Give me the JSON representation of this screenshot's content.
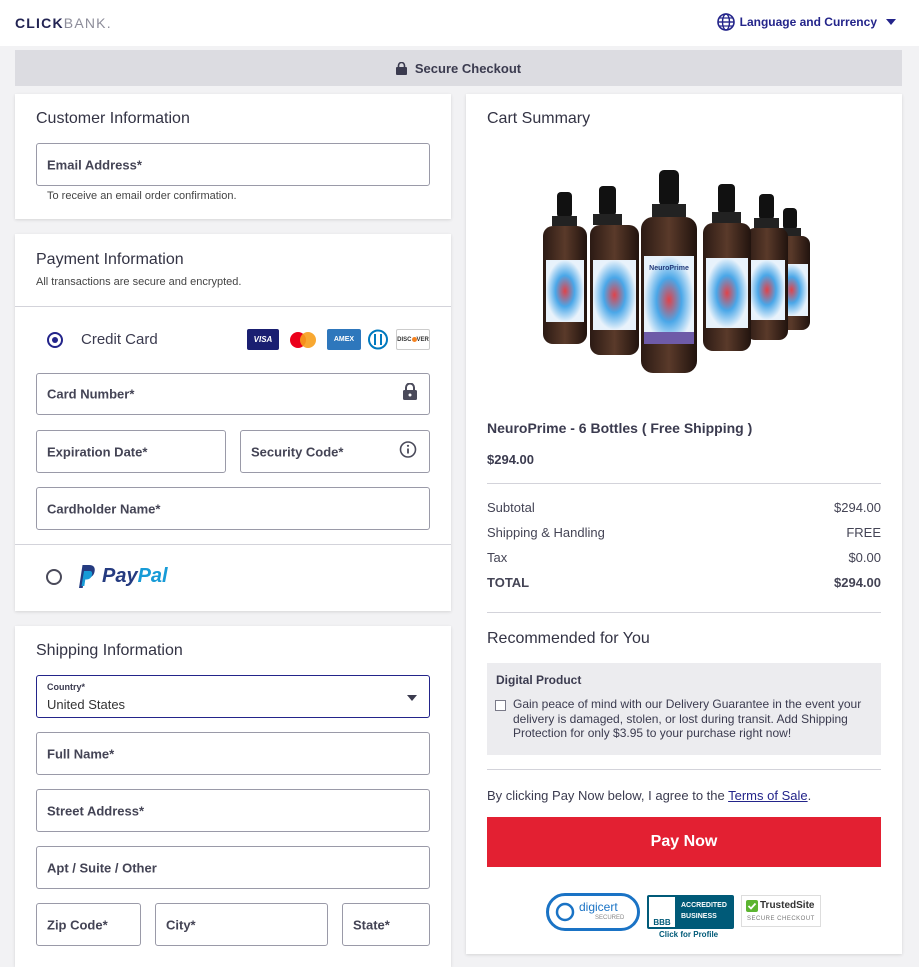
{
  "header": {
    "logo_main": "CLICK",
    "logo_secondary": "BANK.",
    "language_label": "Language and Currency"
  },
  "secure_bar": {
    "label": "Secure Checkout"
  },
  "customer": {
    "title": "Customer Information",
    "email_label": "Email Address*",
    "email_hint": "To receive an email order confirmation."
  },
  "payment": {
    "title": "Payment Information",
    "subtitle": "All transactions are secure and encrypted.",
    "credit_card_label": "Credit Card",
    "card_brands": [
      "VISA",
      "MC",
      "AMEX",
      "DINERS",
      "DISCOVER"
    ],
    "card_number_label": "Card Number*",
    "expiration_label": "Expiration Date*",
    "security_code_label": "Security Code*",
    "cardholder_label": "Cardholder Name*",
    "paypal_label_1": "Pay",
    "paypal_label_2": "Pal",
    "selected_method": "credit_card"
  },
  "shipping": {
    "title": "Shipping Information",
    "country_label": "Country*",
    "country_value": "United States",
    "full_name_label": "Full Name*",
    "street_label": "Street Address*",
    "apt_label": "Apt / Suite / Other",
    "zip_label": "Zip Code*",
    "city_label": "City*",
    "state_label": "State*"
  },
  "cart": {
    "title": "Cart Summary",
    "product_name": "NeuroPrime - 6 Bottles ( Free Shipping )",
    "product_price": "$294.00",
    "bottle_brand": "NeuroPrime",
    "lines": [
      {
        "label": "Subtotal",
        "value": "$294.00"
      },
      {
        "label": "Shipping & Handling",
        "value": "FREE"
      },
      {
        "label": "Tax",
        "value": "$0.00"
      },
      {
        "label": "TOTAL",
        "value": "$294.00"
      }
    ],
    "recommended_title": "Recommended for You",
    "digital_product_title": "Digital Product",
    "protection_text": "Gain peace of mind with our Delivery Guarantee in the event your delivery is damaged, stolen, or lost during transit. Add Shipping Protection for only $3.95 to your purchase right now!",
    "terms_prefix": "By clicking Pay Now below, I agree to the ",
    "terms_link": "Terms of Sale",
    "terms_suffix": ".",
    "pay_now_label": "Pay Now",
    "badges": {
      "digicert": "digicert",
      "digicert_sub": "SECURED",
      "bbb_line1": "ACCREDITED",
      "bbb_line2": "BUSINESS",
      "bbb_logo": "BBB",
      "bbb_sub": "Click for Profile",
      "trusted": "TrustedSite",
      "trusted_sub": "SECURE CHECKOUT"
    }
  },
  "colors": {
    "brand": "#23248a",
    "pay_button": "#e32032",
    "paypal_dark": "#253b80",
    "paypal_light": "#179bd7"
  }
}
